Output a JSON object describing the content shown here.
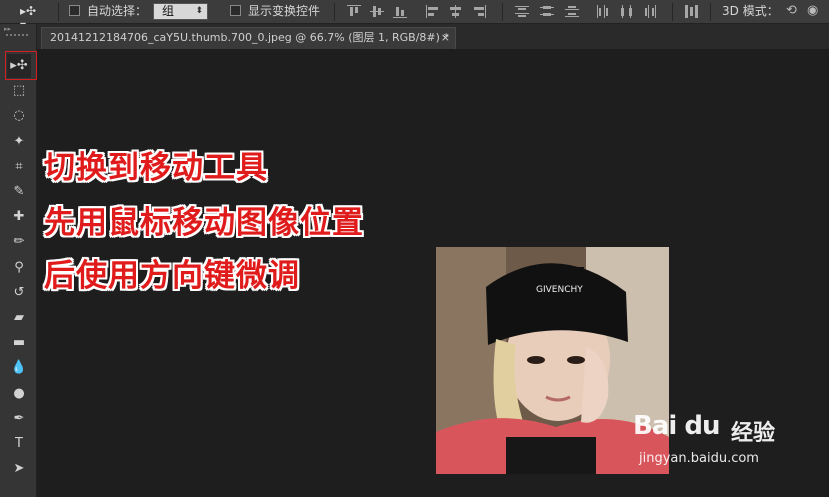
{
  "options_bar": {
    "auto_select_label": "自动选择：",
    "auto_select_value": "组",
    "show_transform_label": "显示变换控件",
    "mode_label": "3D 模式："
  },
  "document_tab": {
    "title": "20141212184706_caY5U.thumb.700_0.jpeg @ 66.7% (图层 1, RGB/8#) *",
    "close_glyph": "×"
  },
  "tools": [
    {
      "name": "move-tool",
      "glyph": "▸✣"
    },
    {
      "name": "marquee-tool",
      "glyph": "⬚"
    },
    {
      "name": "lasso-tool",
      "glyph": "◌"
    },
    {
      "name": "quick-select-tool",
      "glyph": "✦"
    },
    {
      "name": "crop-tool",
      "glyph": "⌗"
    },
    {
      "name": "eyedropper-tool",
      "glyph": "✎"
    },
    {
      "name": "healing-tool",
      "glyph": "✚"
    },
    {
      "name": "brush-tool",
      "glyph": "✏"
    },
    {
      "name": "stamp-tool",
      "glyph": "⚲"
    },
    {
      "name": "history-brush-tool",
      "glyph": "↺"
    },
    {
      "name": "eraser-tool",
      "glyph": "▰"
    },
    {
      "name": "gradient-tool",
      "glyph": "▬"
    },
    {
      "name": "blur-tool",
      "glyph": "💧"
    },
    {
      "name": "dodge-tool",
      "glyph": "●"
    },
    {
      "name": "pen-tool",
      "glyph": "✒"
    },
    {
      "name": "type-tool",
      "glyph": "T"
    },
    {
      "name": "path-select-tool",
      "glyph": "➤"
    }
  ],
  "annotation": {
    "line1": "切换到移动工具",
    "line2": "先用鼠标移动图像位置",
    "line3": "后使用方向键微调"
  },
  "watermark": {
    "logo": "Bai du",
    "brand": "经验",
    "url": "jingyan.baidu.com"
  },
  "colors": {
    "annotation_red": "#e01b1b",
    "highlight_box": "#d21f1f",
    "canvas_bg": "#1e1e1e"
  }
}
